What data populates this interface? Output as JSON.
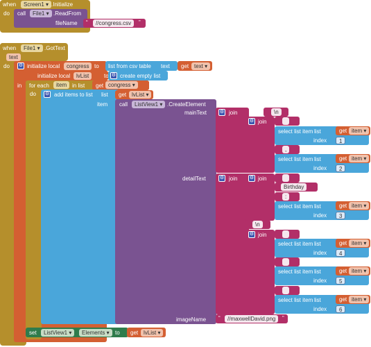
{
  "screen_init": {
    "when": "when",
    "component": "Screen1",
    "event": ".Initialize",
    "do": "do"
  },
  "read_from": {
    "call": "call",
    "component": "File1",
    "method": ".ReadFrom",
    "param": "fileName",
    "file": "//congress.csv"
  },
  "got_text": {
    "when": "when",
    "component": "File1",
    "event": ".GotText",
    "param": "text",
    "do": "do"
  },
  "init_congress": {
    "label": "initialize local",
    "name": "congress",
    "to": "to",
    "value": "list from csv table",
    "value_param": "text",
    "get": "get",
    "get_value": "text"
  },
  "init_lvlist": {
    "label": "initialize local",
    "name": "lvList",
    "to": "to",
    "value": "create empty list"
  },
  "in_label": "in",
  "foreach": {
    "label": "for each",
    "item": "item",
    "in_list": "in list",
    "get": "get",
    "list": "congress",
    "do": "do"
  },
  "add_items": {
    "label": "add items to list",
    "list_param": "list",
    "get": "get",
    "list_value": "lvList",
    "item_param": "item"
  },
  "create_element": {
    "call": "call",
    "component": "ListView1",
    "method": ".CreateElement",
    "main": "mainText",
    "detail": "detailText",
    "image": "imageName",
    "image_value": "//maxwellDavid.png"
  },
  "join_label": "join",
  "select_label": "select list item",
  "list_label": "list",
  "index_label": "index",
  "get_label": "get",
  "item_var": "item",
  "strings": {
    "newline": "\\n",
    "empty": "",
    "comma": ",",
    "birthday": "Birthday",
    "colon": ":"
  },
  "indices": [
    "1",
    "2",
    "3",
    "4",
    "5",
    "6"
  ],
  "set_block": {
    "set": "set",
    "component": "ListView1",
    "property": "Elements",
    "to": "to",
    "get": "get",
    "value": "lvList"
  }
}
